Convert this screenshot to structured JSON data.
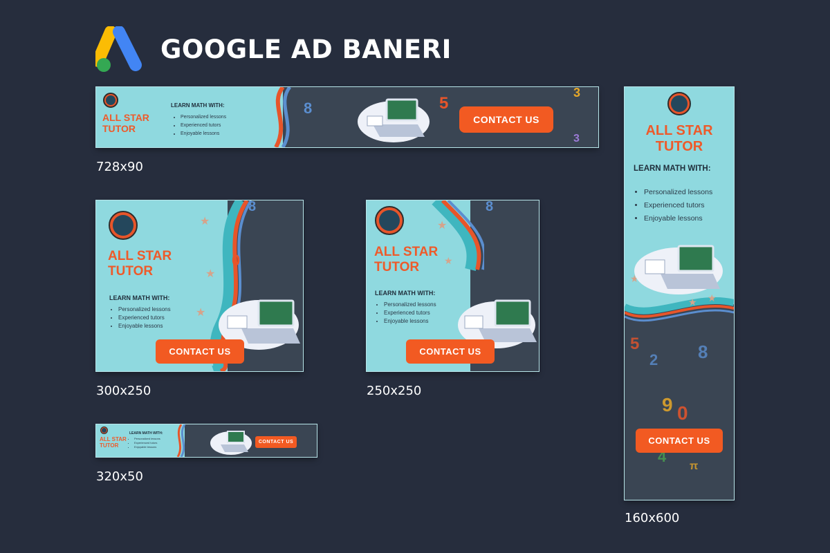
{
  "page": {
    "title": "GOOGLE AD BANERI"
  },
  "logo": {
    "icon": "google-ads-logo",
    "colors": [
      "#fbbc04",
      "#4285f4",
      "#34a853"
    ]
  },
  "ad": {
    "brand_line1": "ALL STAR",
    "brand_line2": "TUTOR",
    "learn_heading": "LEARN MATH WITH:",
    "bullets": [
      "Personalized lessons",
      "Experienced tutors",
      "Enjoyable lessons"
    ],
    "cta": "CONTACT US",
    "colors": {
      "teal": "#8fd9df",
      "dark": "#3a4553",
      "orange": "#f25a22",
      "brand": "#ee5a2a"
    }
  },
  "sizes": {
    "leaderboard": "728x90",
    "rectangle": "300x250",
    "square": "250x250",
    "mobile": "320x50",
    "skyscraper": "160x600"
  }
}
